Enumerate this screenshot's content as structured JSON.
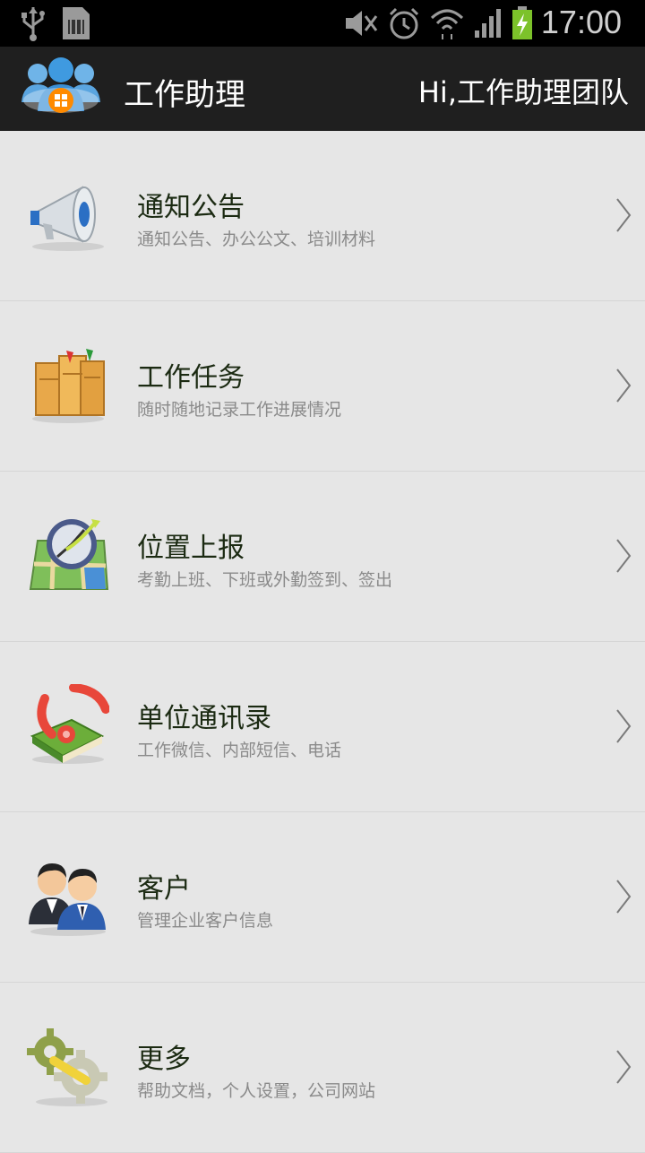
{
  "status_bar": {
    "time": "17:00",
    "icons": [
      "usb-icon",
      "sim-card-icon",
      "mute-icon",
      "alarm-icon",
      "wifi-icon",
      "signal-icon",
      "battery-charging-icon"
    ]
  },
  "app_bar": {
    "title": "工作助理",
    "greeting": "Hi,工作助理团队",
    "logo_icon": "team-logo-icon"
  },
  "menu": [
    {
      "title": "通知公告",
      "subtitle": "通知公告、办公公文、培训材料",
      "icon": "megaphone-icon"
    },
    {
      "title": "工作任务",
      "subtitle": "随时随地记录工作进展情况",
      "icon": "folders-icon"
    },
    {
      "title": "位置上报",
      "subtitle": "考勤上班、下班或外勤签到、签出",
      "icon": "map-compass-icon"
    },
    {
      "title": "单位通讯录",
      "subtitle": "工作微信、内部短信、电话",
      "icon": "phone-book-icon"
    },
    {
      "title": "客户",
      "subtitle": "管理企业客户信息",
      "icon": "customers-icon"
    },
    {
      "title": "更多",
      "subtitle": "帮助文档，个人设置，公司网站",
      "icon": "gears-icon"
    }
  ]
}
